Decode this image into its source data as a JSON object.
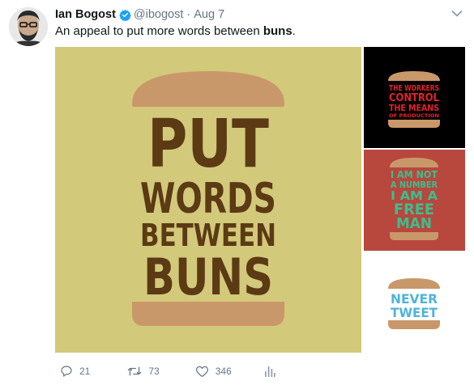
{
  "tweet": {
    "display_name": "Ian Bogost",
    "handle": "@ibogost",
    "separator": "·",
    "date": "Aug 7",
    "text_prefix": "An appeal to put more words between ",
    "text_bold": "buns",
    "text_suffix": "."
  },
  "media": {
    "main_lines": [
      "PUT",
      "WORDS",
      "BETWEEN",
      "BUNS"
    ],
    "thumb1_lines": [
      "THE WORKERS",
      "CONTROL",
      "THE MEANS",
      "OF PRODUCTION"
    ],
    "thumb2_lines": [
      "I AM NOT",
      "A NUMBER",
      "I AM A",
      "FREE",
      "MAN"
    ],
    "thumb3_lines": [
      "NEVER",
      "TWEET"
    ],
    "colors": {
      "main_bg": "#d2c97a",
      "bun": "#c9986a",
      "main_text": "#5b3a14",
      "thumb1_text": "#e4222a",
      "thumb2_text": "#3bbf8e",
      "thumb3_text": "#4fb3d9"
    }
  },
  "actions": {
    "reply_count": "21",
    "retweet_count": "73",
    "like_count": "346",
    "icons": [
      "reply-icon",
      "retweet-icon",
      "like-icon",
      "analytics-icon"
    ]
  },
  "colors": {
    "verified": "#1da1f2",
    "muted": "#657786"
  }
}
